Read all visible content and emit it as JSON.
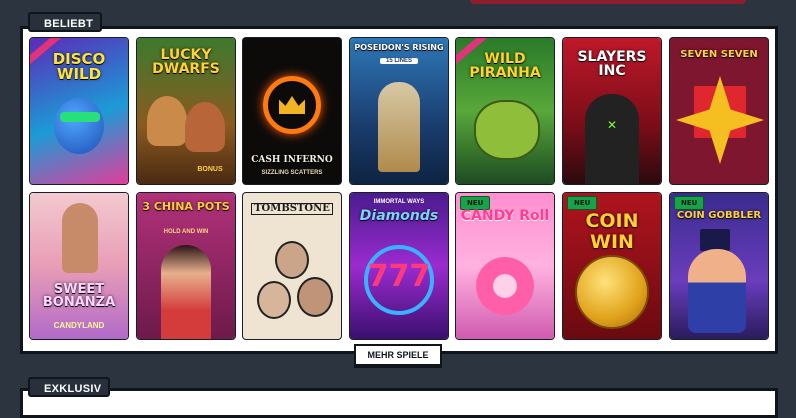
{
  "sections": {
    "popular_label": "BELIEBT",
    "exclusive_label": "EXKLUSIV"
  },
  "more_button": "MEHR SPIELE",
  "games_row1": [
    {
      "title": "DISCO WILD",
      "badge": ""
    },
    {
      "title": "LUCKY DWARFS",
      "sub": "BONUS",
      "badge": ""
    },
    {
      "title": "CASH INFERNO",
      "sub": "SIZZLING SCATTERS",
      "badge": ""
    },
    {
      "title": "POSEIDON'S RISING",
      "sub": "15 LINES",
      "badge": ""
    },
    {
      "title": "WILD PIRANHA",
      "badge": ""
    },
    {
      "title": "SLAYERS INC",
      "badge": ""
    },
    {
      "title": "SEVEN SEVEN",
      "badge": ""
    }
  ],
  "games_row2": [
    {
      "title": "SWEET BONANZA",
      "sub": "CANDYLAND",
      "badge": ""
    },
    {
      "title": "3 CHINA POTS",
      "sub": "HOLD AND WIN",
      "badge": ""
    },
    {
      "title": "TOMBSTONE",
      "badge": ""
    },
    {
      "title": "Diamonds",
      "sub": "IMMORTAL WAYS",
      "badge": ""
    },
    {
      "title": "CANDY Roll",
      "badge": "NEU"
    },
    {
      "title": "COIN WIN",
      "badge": "NEU"
    },
    {
      "title": "COIN GOBBLER",
      "badge": "NEU"
    }
  ],
  "colors": {
    "page_bg": "#2c3440",
    "panel_bg": "#ffffff",
    "badge_new": "#17a34a"
  }
}
